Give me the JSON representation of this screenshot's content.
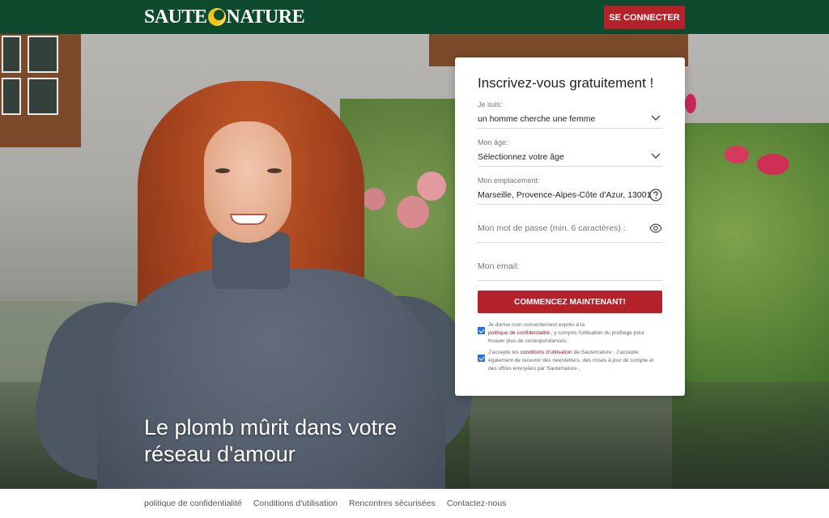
{
  "header": {
    "logo_text_left": "SAUTE",
    "logo_text_right": "NATURE",
    "login_label": "SE CONNECTER"
  },
  "hero": {
    "tagline": "Le plomb mûrit dans votre réseau d'amour"
  },
  "signup": {
    "title": "Inscrivez-vous gratuitement !",
    "seeking": {
      "label": "Je suis:",
      "value": "un homme cherche une femme"
    },
    "age": {
      "label": "Mon âge:",
      "value": "Sélectionnez votre âge"
    },
    "location": {
      "label": "Mon emplacement:",
      "value": "Marseille, Provence-Alpes-Côte d'Azur, 13001"
    },
    "password": {
      "placeholder": "Mon mot de passe (min. 6 caractères) :"
    },
    "email": {
      "placeholder": "Mon email:"
    },
    "cta_label": "COMMENCEZ MAINTENANT!",
    "consent_privacy": {
      "checked": true,
      "text_before": "Je donne mon consentement exprès à la",
      "link": "politique de confidentialité",
      "text_after": ", y compris l'utilisation du profilage pour trouver plus de correspondances."
    },
    "consent_terms": {
      "checked": true,
      "text_before": "J'accepte les",
      "link": "conditions d'utilisation",
      "text_after": "de Sautemature . J'accepte également de recevoir des newsletters, des mises à jour de compte et des offres envoyées par Sautemature ."
    }
  },
  "footer": {
    "links": [
      "politique de confidentialité",
      "Conditions d'utilisation",
      "Rencontres sécurisées",
      "Contactez-nous"
    ]
  },
  "colors": {
    "header_bg": "#0e4a2e",
    "accent_red": "#b42129",
    "checkbox_blue": "#2a73d6"
  }
}
